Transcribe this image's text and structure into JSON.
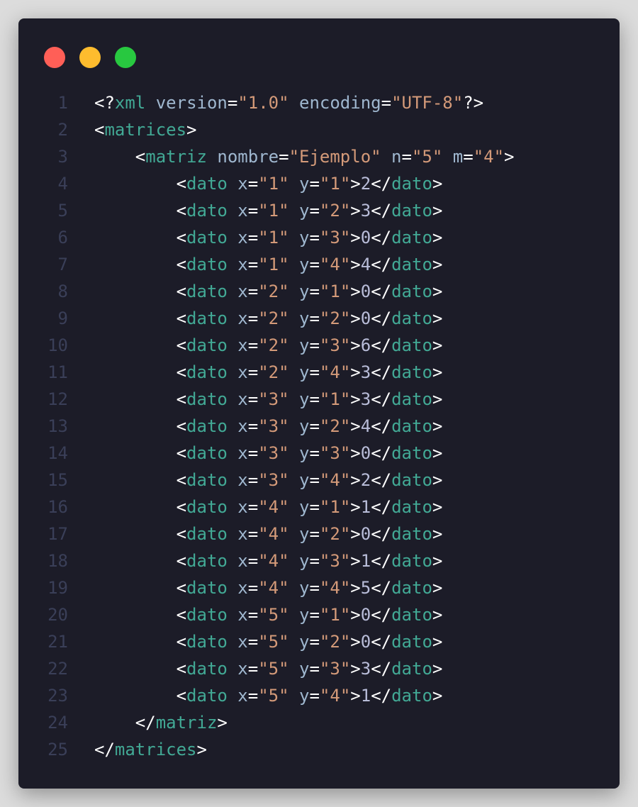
{
  "colors": {
    "background": "#dcdcdc",
    "window": "#1c1c28",
    "line_number": "#3a3f58",
    "punctuation": "#ffffff",
    "tag": "#42a995",
    "attribute": "#9fb7cf",
    "string": "#d49a79",
    "text": "#b9bdd9",
    "dot_close": "#ff5f57",
    "dot_minimize": "#febc2e",
    "dot_maximize": "#28c840"
  },
  "window_controls": [
    {
      "name": "close-dot",
      "color": "#ff5f57"
    },
    {
      "name": "minimize-dot",
      "color": "#febc2e"
    },
    {
      "name": "maximize-dot",
      "color": "#28c840"
    }
  ],
  "code_lines": [
    {
      "n": "1",
      "tokens": [
        [
          "punct",
          "<?"
        ],
        [
          "tag",
          "xml"
        ],
        [
          "attr",
          " version"
        ],
        [
          "punct",
          "="
        ],
        [
          "str",
          "\"1.0\""
        ],
        [
          "attr",
          " encoding"
        ],
        [
          "punct",
          "="
        ],
        [
          "str",
          "\"UTF-8\""
        ],
        [
          "punct",
          "?>"
        ]
      ]
    },
    {
      "n": "2",
      "tokens": [
        [
          "punct",
          "<"
        ],
        [
          "tag",
          "matrices"
        ],
        [
          "punct",
          ">"
        ]
      ]
    },
    {
      "n": "3",
      "tokens": [
        [
          "punct",
          "    <"
        ],
        [
          "tag",
          "matriz"
        ],
        [
          "attr",
          " nombre"
        ],
        [
          "punct",
          "="
        ],
        [
          "str",
          "\"Ejemplo\""
        ],
        [
          "attr",
          " n"
        ],
        [
          "punct",
          "="
        ],
        [
          "str",
          "\"5\""
        ],
        [
          "attr",
          " m"
        ],
        [
          "punct",
          "="
        ],
        [
          "str",
          "\"4\""
        ],
        [
          "punct",
          ">"
        ]
      ]
    },
    {
      "n": "4",
      "tokens": [
        [
          "punct",
          "        <"
        ],
        [
          "tag",
          "dato"
        ],
        [
          "attr",
          " x"
        ],
        [
          "punct",
          "="
        ],
        [
          "str",
          "\"1\""
        ],
        [
          "attr",
          " y"
        ],
        [
          "punct",
          "="
        ],
        [
          "str",
          "\"1\""
        ],
        [
          "punct",
          ">"
        ],
        [
          "text",
          "2"
        ],
        [
          "punct",
          "</"
        ],
        [
          "tag",
          "dato"
        ],
        [
          "punct",
          ">"
        ]
      ]
    },
    {
      "n": "5",
      "tokens": [
        [
          "punct",
          "        <"
        ],
        [
          "tag",
          "dato"
        ],
        [
          "attr",
          " x"
        ],
        [
          "punct",
          "="
        ],
        [
          "str",
          "\"1\""
        ],
        [
          "attr",
          " y"
        ],
        [
          "punct",
          "="
        ],
        [
          "str",
          "\"2\""
        ],
        [
          "punct",
          ">"
        ],
        [
          "text",
          "3"
        ],
        [
          "punct",
          "</"
        ],
        [
          "tag",
          "dato"
        ],
        [
          "punct",
          ">"
        ]
      ]
    },
    {
      "n": "6",
      "tokens": [
        [
          "punct",
          "        <"
        ],
        [
          "tag",
          "dato"
        ],
        [
          "attr",
          " x"
        ],
        [
          "punct",
          "="
        ],
        [
          "str",
          "\"1\""
        ],
        [
          "attr",
          " y"
        ],
        [
          "punct",
          "="
        ],
        [
          "str",
          "\"3\""
        ],
        [
          "punct",
          ">"
        ],
        [
          "text",
          "0"
        ],
        [
          "punct",
          "</"
        ],
        [
          "tag",
          "dato"
        ],
        [
          "punct",
          ">"
        ]
      ]
    },
    {
      "n": "7",
      "tokens": [
        [
          "punct",
          "        <"
        ],
        [
          "tag",
          "dato"
        ],
        [
          "attr",
          " x"
        ],
        [
          "punct",
          "="
        ],
        [
          "str",
          "\"1\""
        ],
        [
          "attr",
          " y"
        ],
        [
          "punct",
          "="
        ],
        [
          "str",
          "\"4\""
        ],
        [
          "punct",
          ">"
        ],
        [
          "text",
          "4"
        ],
        [
          "punct",
          "</"
        ],
        [
          "tag",
          "dato"
        ],
        [
          "punct",
          ">"
        ]
      ]
    },
    {
      "n": "8",
      "tokens": [
        [
          "punct",
          "        <"
        ],
        [
          "tag",
          "dato"
        ],
        [
          "attr",
          " x"
        ],
        [
          "punct",
          "="
        ],
        [
          "str",
          "\"2\""
        ],
        [
          "attr",
          " y"
        ],
        [
          "punct",
          "="
        ],
        [
          "str",
          "\"1\""
        ],
        [
          "punct",
          ">"
        ],
        [
          "text",
          "0"
        ],
        [
          "punct",
          "</"
        ],
        [
          "tag",
          "dato"
        ],
        [
          "punct",
          ">"
        ]
      ]
    },
    {
      "n": "9",
      "tokens": [
        [
          "punct",
          "        <"
        ],
        [
          "tag",
          "dato"
        ],
        [
          "attr",
          " x"
        ],
        [
          "punct",
          "="
        ],
        [
          "str",
          "\"2\""
        ],
        [
          "attr",
          " y"
        ],
        [
          "punct",
          "="
        ],
        [
          "str",
          "\"2\""
        ],
        [
          "punct",
          ">"
        ],
        [
          "text",
          "0"
        ],
        [
          "punct",
          "</"
        ],
        [
          "tag",
          "dato"
        ],
        [
          "punct",
          ">"
        ]
      ]
    },
    {
      "n": "10",
      "tokens": [
        [
          "punct",
          "        <"
        ],
        [
          "tag",
          "dato"
        ],
        [
          "attr",
          " x"
        ],
        [
          "punct",
          "="
        ],
        [
          "str",
          "\"2\""
        ],
        [
          "attr",
          " y"
        ],
        [
          "punct",
          "="
        ],
        [
          "str",
          "\"3\""
        ],
        [
          "punct",
          ">"
        ],
        [
          "text",
          "6"
        ],
        [
          "punct",
          "</"
        ],
        [
          "tag",
          "dato"
        ],
        [
          "punct",
          ">"
        ]
      ]
    },
    {
      "n": "11",
      "tokens": [
        [
          "punct",
          "        <"
        ],
        [
          "tag",
          "dato"
        ],
        [
          "attr",
          " x"
        ],
        [
          "punct",
          "="
        ],
        [
          "str",
          "\"2\""
        ],
        [
          "attr",
          " y"
        ],
        [
          "punct",
          "="
        ],
        [
          "str",
          "\"4\""
        ],
        [
          "punct",
          ">"
        ],
        [
          "text",
          "3"
        ],
        [
          "punct",
          "</"
        ],
        [
          "tag",
          "dato"
        ],
        [
          "punct",
          ">"
        ]
      ]
    },
    {
      "n": "12",
      "tokens": [
        [
          "punct",
          "        <"
        ],
        [
          "tag",
          "dato"
        ],
        [
          "attr",
          " x"
        ],
        [
          "punct",
          "="
        ],
        [
          "str",
          "\"3\""
        ],
        [
          "attr",
          " y"
        ],
        [
          "punct",
          "="
        ],
        [
          "str",
          "\"1\""
        ],
        [
          "punct",
          ">"
        ],
        [
          "text",
          "3"
        ],
        [
          "punct",
          "</"
        ],
        [
          "tag",
          "dato"
        ],
        [
          "punct",
          ">"
        ]
      ]
    },
    {
      "n": "13",
      "tokens": [
        [
          "punct",
          "        <"
        ],
        [
          "tag",
          "dato"
        ],
        [
          "attr",
          " x"
        ],
        [
          "punct",
          "="
        ],
        [
          "str",
          "\"3\""
        ],
        [
          "attr",
          " y"
        ],
        [
          "punct",
          "="
        ],
        [
          "str",
          "\"2\""
        ],
        [
          "punct",
          ">"
        ],
        [
          "text",
          "4"
        ],
        [
          "punct",
          "</"
        ],
        [
          "tag",
          "dato"
        ],
        [
          "punct",
          ">"
        ]
      ]
    },
    {
      "n": "14",
      "tokens": [
        [
          "punct",
          "        <"
        ],
        [
          "tag",
          "dato"
        ],
        [
          "attr",
          " x"
        ],
        [
          "punct",
          "="
        ],
        [
          "str",
          "\"3\""
        ],
        [
          "attr",
          " y"
        ],
        [
          "punct",
          "="
        ],
        [
          "str",
          "\"3\""
        ],
        [
          "punct",
          ">"
        ],
        [
          "text",
          "0"
        ],
        [
          "punct",
          "</"
        ],
        [
          "tag",
          "dato"
        ],
        [
          "punct",
          ">"
        ]
      ]
    },
    {
      "n": "15",
      "tokens": [
        [
          "punct",
          "        <"
        ],
        [
          "tag",
          "dato"
        ],
        [
          "attr",
          " x"
        ],
        [
          "punct",
          "="
        ],
        [
          "str",
          "\"3\""
        ],
        [
          "attr",
          " y"
        ],
        [
          "punct",
          "="
        ],
        [
          "str",
          "\"4\""
        ],
        [
          "punct",
          ">"
        ],
        [
          "text",
          "2"
        ],
        [
          "punct",
          "</"
        ],
        [
          "tag",
          "dato"
        ],
        [
          "punct",
          ">"
        ]
      ]
    },
    {
      "n": "16",
      "tokens": [
        [
          "punct",
          "        <"
        ],
        [
          "tag",
          "dato"
        ],
        [
          "attr",
          " x"
        ],
        [
          "punct",
          "="
        ],
        [
          "str",
          "\"4\""
        ],
        [
          "attr",
          " y"
        ],
        [
          "punct",
          "="
        ],
        [
          "str",
          "\"1\""
        ],
        [
          "punct",
          ">"
        ],
        [
          "text",
          "1"
        ],
        [
          "punct",
          "</"
        ],
        [
          "tag",
          "dato"
        ],
        [
          "punct",
          ">"
        ]
      ]
    },
    {
      "n": "17",
      "tokens": [
        [
          "punct",
          "        <"
        ],
        [
          "tag",
          "dato"
        ],
        [
          "attr",
          " x"
        ],
        [
          "punct",
          "="
        ],
        [
          "str",
          "\"4\""
        ],
        [
          "attr",
          " y"
        ],
        [
          "punct",
          "="
        ],
        [
          "str",
          "\"2\""
        ],
        [
          "punct",
          ">"
        ],
        [
          "text",
          "0"
        ],
        [
          "punct",
          "</"
        ],
        [
          "tag",
          "dato"
        ],
        [
          "punct",
          ">"
        ]
      ]
    },
    {
      "n": "18",
      "tokens": [
        [
          "punct",
          "        <"
        ],
        [
          "tag",
          "dato"
        ],
        [
          "attr",
          " x"
        ],
        [
          "punct",
          "="
        ],
        [
          "str",
          "\"4\""
        ],
        [
          "attr",
          " y"
        ],
        [
          "punct",
          "="
        ],
        [
          "str",
          "\"3\""
        ],
        [
          "punct",
          ">"
        ],
        [
          "text",
          "1"
        ],
        [
          "punct",
          "</"
        ],
        [
          "tag",
          "dato"
        ],
        [
          "punct",
          ">"
        ]
      ]
    },
    {
      "n": "19",
      "tokens": [
        [
          "punct",
          "        <"
        ],
        [
          "tag",
          "dato"
        ],
        [
          "attr",
          " x"
        ],
        [
          "punct",
          "="
        ],
        [
          "str",
          "\"4\""
        ],
        [
          "attr",
          " y"
        ],
        [
          "punct",
          "="
        ],
        [
          "str",
          "\"4\""
        ],
        [
          "punct",
          ">"
        ],
        [
          "text",
          "5"
        ],
        [
          "punct",
          "</"
        ],
        [
          "tag",
          "dato"
        ],
        [
          "punct",
          ">"
        ]
      ]
    },
    {
      "n": "20",
      "tokens": [
        [
          "punct",
          "        <"
        ],
        [
          "tag",
          "dato"
        ],
        [
          "attr",
          " x"
        ],
        [
          "punct",
          "="
        ],
        [
          "str",
          "\"5\""
        ],
        [
          "attr",
          " y"
        ],
        [
          "punct",
          "="
        ],
        [
          "str",
          "\"1\""
        ],
        [
          "punct",
          ">"
        ],
        [
          "text",
          "0"
        ],
        [
          "punct",
          "</"
        ],
        [
          "tag",
          "dato"
        ],
        [
          "punct",
          ">"
        ]
      ]
    },
    {
      "n": "21",
      "tokens": [
        [
          "punct",
          "        <"
        ],
        [
          "tag",
          "dato"
        ],
        [
          "attr",
          " x"
        ],
        [
          "punct",
          "="
        ],
        [
          "str",
          "\"5\""
        ],
        [
          "attr",
          " y"
        ],
        [
          "punct",
          "="
        ],
        [
          "str",
          "\"2\""
        ],
        [
          "punct",
          ">"
        ],
        [
          "text",
          "0"
        ],
        [
          "punct",
          "</"
        ],
        [
          "tag",
          "dato"
        ],
        [
          "punct",
          ">"
        ]
      ]
    },
    {
      "n": "22",
      "tokens": [
        [
          "punct",
          "        <"
        ],
        [
          "tag",
          "dato"
        ],
        [
          "attr",
          " x"
        ],
        [
          "punct",
          "="
        ],
        [
          "str",
          "\"5\""
        ],
        [
          "attr",
          " y"
        ],
        [
          "punct",
          "="
        ],
        [
          "str",
          "\"3\""
        ],
        [
          "punct",
          ">"
        ],
        [
          "text",
          "3"
        ],
        [
          "punct",
          "</"
        ],
        [
          "tag",
          "dato"
        ],
        [
          "punct",
          ">"
        ]
      ]
    },
    {
      "n": "23",
      "tokens": [
        [
          "punct",
          "        <"
        ],
        [
          "tag",
          "dato"
        ],
        [
          "attr",
          " x"
        ],
        [
          "punct",
          "="
        ],
        [
          "str",
          "\"5\""
        ],
        [
          "attr",
          " y"
        ],
        [
          "punct",
          "="
        ],
        [
          "str",
          "\"4\""
        ],
        [
          "punct",
          ">"
        ],
        [
          "text",
          "1"
        ],
        [
          "punct",
          "</"
        ],
        [
          "tag",
          "dato"
        ],
        [
          "punct",
          ">"
        ]
      ]
    },
    {
      "n": "24",
      "tokens": [
        [
          "punct",
          "    </"
        ],
        [
          "tag",
          "matriz"
        ],
        [
          "punct",
          ">"
        ]
      ]
    },
    {
      "n": "25",
      "tokens": [
        [
          "punct",
          "</"
        ],
        [
          "tag",
          "matrices"
        ],
        [
          "punct",
          ">"
        ]
      ]
    }
  ]
}
